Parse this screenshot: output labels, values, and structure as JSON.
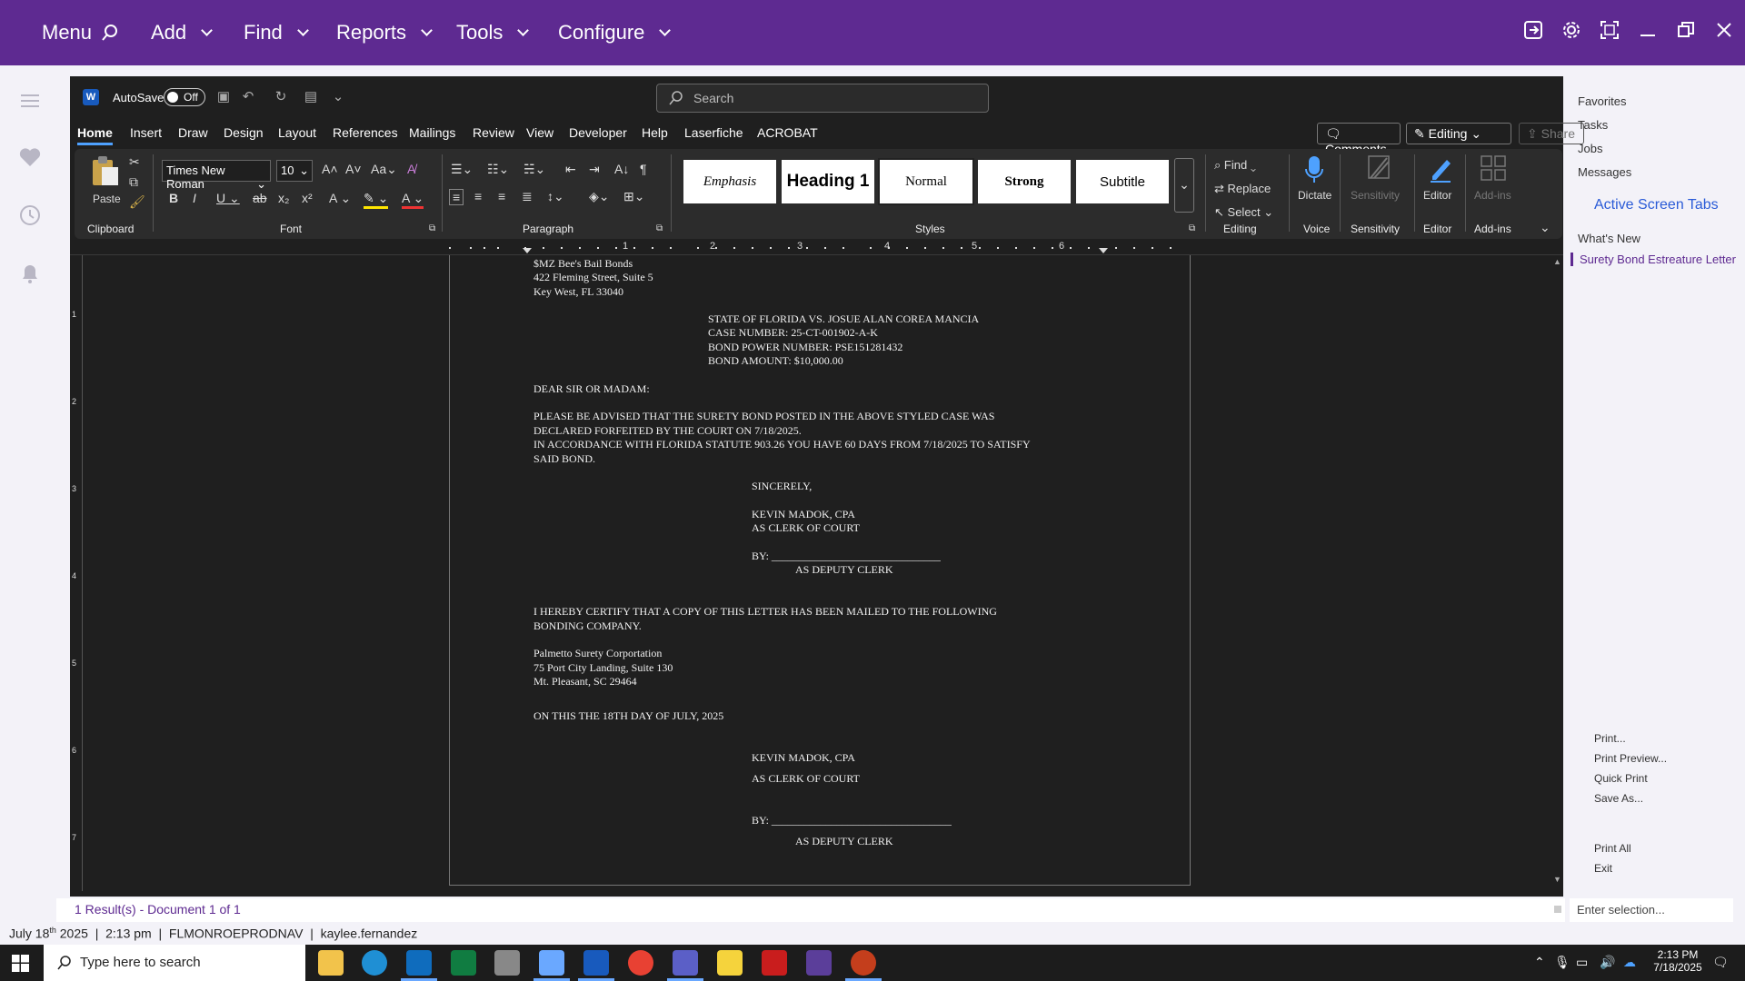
{
  "topbar": {
    "menus": [
      {
        "label": "Menu"
      },
      {
        "label": "Add"
      },
      {
        "label": "Find"
      },
      {
        "label": "Reports"
      },
      {
        "label": "Tools"
      },
      {
        "label": "Configure"
      }
    ],
    "icons": [
      "sign-out-icon",
      "gear-icon",
      "fullscreen-icon",
      "minimize-icon",
      "restore-icon",
      "close-icon"
    ]
  },
  "word": {
    "autosave_label": "AutoSave",
    "autosave_state": "Off",
    "search_placeholder": "Search",
    "tabs": [
      "Home",
      "Insert",
      "Draw",
      "Design",
      "Layout",
      "References",
      "Mailings",
      "Review",
      "View",
      "Developer",
      "Help",
      "Laserfiche",
      "ACROBAT"
    ],
    "comments_label": "Comments",
    "editing_label": "Editing",
    "share_label": "Share",
    "ribbon": {
      "paste_label": "Paste",
      "font_name": "Times New Roman",
      "font_size": "10",
      "styles": [
        "Emphasis",
        "Heading 1",
        "Normal",
        "Strong",
        "Subtitle"
      ],
      "find_label": "Find",
      "replace_label": "Replace",
      "select_label": "Select",
      "dictate_label": "Dictate",
      "sensitivity_label": "Sensitivity",
      "editor_label": "Editor",
      "addins_label": "Add-ins",
      "groups": [
        "Clipboard",
        "Font",
        "Paragraph",
        "Styles",
        "Editing",
        "Voice",
        "Sensitivity",
        "Editor",
        "Add-ins"
      ]
    },
    "ruler_numbers": [
      "1",
      "2",
      "3",
      "4",
      "5",
      "6"
    ],
    "vruler_numbers": [
      "1",
      "2",
      "3",
      "4",
      "5",
      "6",
      "7"
    ],
    "document": {
      "lines": [
        "$MZ Bee's Bail Bonds",
        "422 Fleming Street, Suite 5",
        "Key West, FL 33040",
        "STATE OF FLORIDA VS. JOSUE ALAN COREA MANCIA",
        "CASE NUMBER: 25-CT-001902-A-K",
        "BOND POWER NUMBER: PSE151281432",
        "BOND AMOUNT: $10,000.00",
        "DEAR SIR OR MADAM:",
        "PLEASE BE ADVISED THAT THE SURETY BOND POSTED IN THE ABOVE STYLED CASE WAS",
        "DECLARED FORFEITED BY THE COURT ON 7/18/2025.",
        "IN ACCORDANCE WITH FLORIDA STATUTE 903.26 YOU HAVE 60 DAYS FROM 7/18/2025 TO SATISFY",
        "SAID BOND.",
        "SINCERELY,",
        "KEVIN MADOK, CPA",
        "AS CLERK OF COURT",
        "BY: _______________________________",
        "AS DEPUTY CLERK",
        "I HEREBY CERTIFY THAT A COPY OF THIS LETTER HAS BEEN MAILED TO THE FOLLOWING",
        "BONDING COMPANY.",
        "Palmetto Surety Corportation",
        "75 Port City Landing, Suite 130",
        "Mt. Pleasant, SC 29464",
        "ON THIS THE 18TH DAY OF JULY, 2025",
        "KEVIN MADOK, CPA",
        "AS CLERK OF COURT",
        "BY: _________________________________",
        "AS DEPUTY CLERK"
      ]
    }
  },
  "rightpanel": {
    "links": [
      "Favorites",
      "Tasks",
      "Jobs",
      "Messages"
    ],
    "active_tabs_heading": "Active Screen Tabs",
    "whats_new": "What's New",
    "active_tab": "Surety Bond Estreature Letter",
    "print_actions": [
      "Print...",
      "Print Preview...",
      "Quick Print",
      "Save As..."
    ],
    "bottom_actions": [
      "Print All",
      "Exit"
    ],
    "enter_selection": "Enter selection..."
  },
  "status": {
    "results": "1 Result(s) - Document 1 of 1",
    "date_day": "July 18",
    "date_suffix": "th",
    "date_rest": " 2025  |  2:13 pm  |  FLMONROEPRODNAV  |  kaylee.fernandez"
  },
  "taskbar": {
    "search_placeholder": "Type here to search",
    "time": "2:13 PM",
    "date": "7/18/2025",
    "colors": {
      "accent": "#5e2a91",
      "word": "#185abd",
      "excel": "#107c41",
      "powerpoint": "#c43e1c",
      "outlook": "#0f6cbd"
    }
  }
}
